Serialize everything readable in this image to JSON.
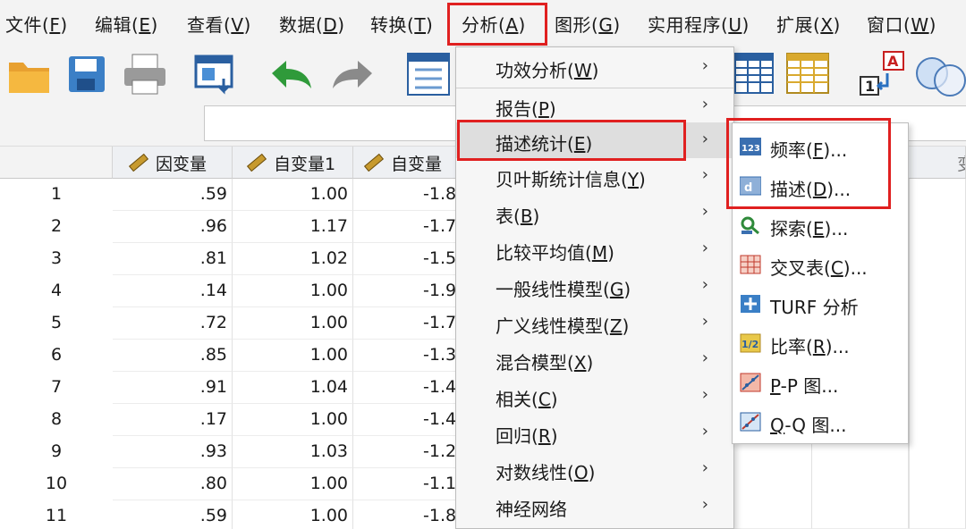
{
  "menubar": {
    "items": [
      {
        "label": "文件(",
        "mn": "F",
        "tail": ")"
      },
      {
        "label": "编辑(",
        "mn": "E",
        "tail": ")"
      },
      {
        "label": "查看(",
        "mn": "V",
        "tail": ")"
      },
      {
        "label": "数据(",
        "mn": "D",
        "tail": ")"
      },
      {
        "label": "转换(",
        "mn": "T",
        "tail": ")"
      },
      {
        "label": "分析(",
        "mn": "A",
        "tail": ")"
      },
      {
        "label": "图形(",
        "mn": "G",
        "tail": ")"
      },
      {
        "label": "实用程序(",
        "mn": "U",
        "tail": ")"
      },
      {
        "label": "扩展(",
        "mn": "X",
        "tail": ")"
      },
      {
        "label": "窗口(",
        "mn": "W",
        "tail": ")"
      }
    ]
  },
  "grid": {
    "headers": [
      "因变量",
      "自变量1",
      "自变量"
    ],
    "right_header_partial": "变",
    "rows": [
      {
        "n": "1",
        "y": ".59",
        "x1": "1.00",
        "x2": "-1.8"
      },
      {
        "n": "2",
        "y": ".96",
        "x1": "1.17",
        "x2": "-1.7"
      },
      {
        "n": "3",
        "y": ".81",
        "x1": "1.02",
        "x2": "-1.5"
      },
      {
        "n": "4",
        "y": ".14",
        "x1": "1.00",
        "x2": "-1.9"
      },
      {
        "n": "5",
        "y": ".72",
        "x1": "1.00",
        "x2": "-1.7"
      },
      {
        "n": "6",
        "y": ".85",
        "x1": "1.00",
        "x2": "-1.3"
      },
      {
        "n": "7",
        "y": ".91",
        "x1": "1.04",
        "x2": "-1.4"
      },
      {
        "n": "8",
        "y": ".17",
        "x1": "1.00",
        "x2": "-1.4"
      },
      {
        "n": "9",
        "y": ".93",
        "x1": "1.03",
        "x2": "-1.2"
      },
      {
        "n": "10",
        "y": ".80",
        "x1": "1.00",
        "x2": "-1.1"
      },
      {
        "n": "11",
        "y": ".59",
        "x1": "1.00",
        "x2": "-1.8"
      }
    ]
  },
  "analyze_menu": {
    "items": [
      {
        "label": "功效分析(",
        "mn": "W",
        "tail": ")"
      },
      {
        "label": "报告(",
        "mn": "P",
        "tail": ")"
      },
      {
        "label": "描述统计(",
        "mn": "E",
        "tail": ")"
      },
      {
        "label": "贝叶斯统计信息(",
        "mn": "Y",
        "tail": ")"
      },
      {
        "label": "表(",
        "mn": "B",
        "tail": ")"
      },
      {
        "label": "比较平均值(",
        "mn": "M",
        "tail": ")"
      },
      {
        "label": "一般线性模型(",
        "mn": "G",
        "tail": ")"
      },
      {
        "label": "广义线性模型(",
        "mn": "Z",
        "tail": ")"
      },
      {
        "label": "混合模型(",
        "mn": "X",
        "tail": ")"
      },
      {
        "label": "相关(",
        "mn": "C",
        "tail": ")"
      },
      {
        "label": "回归(",
        "mn": "R",
        "tail": ")"
      },
      {
        "label": "对数线性(",
        "mn": "O",
        "tail": ")"
      },
      {
        "label": "神经网络",
        "mn": "",
        "tail": ""
      }
    ],
    "chevron": "›"
  },
  "descriptives_submenu": {
    "items": [
      {
        "label": "频率(",
        "mn": "F",
        "tail": ")...",
        "icon": "frequencies-icon"
      },
      {
        "label": "描述(",
        "mn": "D",
        "tail": ")...",
        "icon": "descriptives-icon"
      },
      {
        "label": "探索(",
        "mn": "E",
        "tail": ")...",
        "icon": "explore-icon"
      },
      {
        "label": "交叉表(",
        "mn": "C",
        "tail": ")...",
        "icon": "crosstabs-icon"
      },
      {
        "label": "TURF 分析",
        "mn": "",
        "tail": "",
        "icon": "turf-icon"
      },
      {
        "label": "比率(",
        "mn": "R",
        "tail": ")...",
        "icon": "ratio-icon"
      },
      {
        "label": "",
        "mn": "P",
        "tail": "-P 图...",
        "icon": "pp-plot-icon"
      },
      {
        "label": "",
        "mn": "Q",
        "tail": "-Q 图...",
        "icon": "qq-plot-icon"
      }
    ]
  },
  "colors": {
    "highlight_box": "#e02020",
    "menu_highlight": "#dedede"
  }
}
